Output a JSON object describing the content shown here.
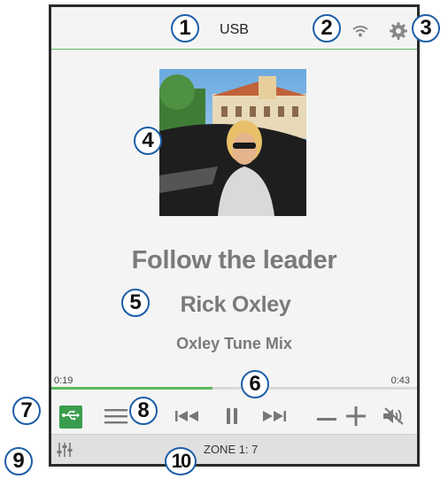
{
  "header": {
    "source": "USB",
    "wifi_icon": "wifi-icon",
    "settings_icon": "gear-icon"
  },
  "now_playing": {
    "album_art": "album-art-photo",
    "title": "Follow the leader",
    "artist": "Rick Oxley",
    "album": "Oxley Tune Mix"
  },
  "progress": {
    "elapsed": "0:19",
    "total": "0:43",
    "fraction": 0.44
  },
  "controls": {
    "source_icon": "usb-icon",
    "browse_icon": "menu-icon",
    "prev_icon": "skip-previous-icon",
    "pause_icon": "pause-icon",
    "next_icon": "skip-next-icon",
    "vol_down_icon": "minus-icon",
    "vol_up_icon": "plus-icon",
    "mute_icon": "mute-icon"
  },
  "footer": {
    "eq_icon": "equalizer-icon",
    "zone": "ZONE 1: 7"
  },
  "callouts": [
    "1",
    "2",
    "3",
    "4",
    "5",
    "6",
    "7",
    "8",
    "9",
    "10"
  ],
  "colors": {
    "accent": "#5cb85c",
    "usb_button": "#3a9d4e",
    "callout_border": "#1c5ea8",
    "text_muted": "#7a7a7a"
  }
}
